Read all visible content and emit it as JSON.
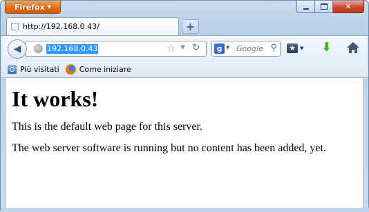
{
  "app_button": {
    "label": "Firefox"
  },
  "tab": {
    "title": "http://192.168.0.43/"
  },
  "newtab": {
    "label": "+"
  },
  "urlbar": {
    "value": "192.168.0.43"
  },
  "searchbar": {
    "engine_letter": "g",
    "placeholder": "Google"
  },
  "bookmarks": [
    {
      "label": "Più visitati",
      "icon": "most-visited-icon"
    },
    {
      "label": "Come iniziare",
      "icon": "firefox-icon"
    }
  ],
  "page": {
    "heading": "It works!",
    "paragraphs": [
      "This is the default web page for this server.",
      "The web server software is running but no content has been added, yet."
    ]
  },
  "colors": {
    "app_button": "#e66a10",
    "url_selection": "#3399ff",
    "download_arrow": "#3fb51d",
    "close_button": "#c9462f"
  }
}
